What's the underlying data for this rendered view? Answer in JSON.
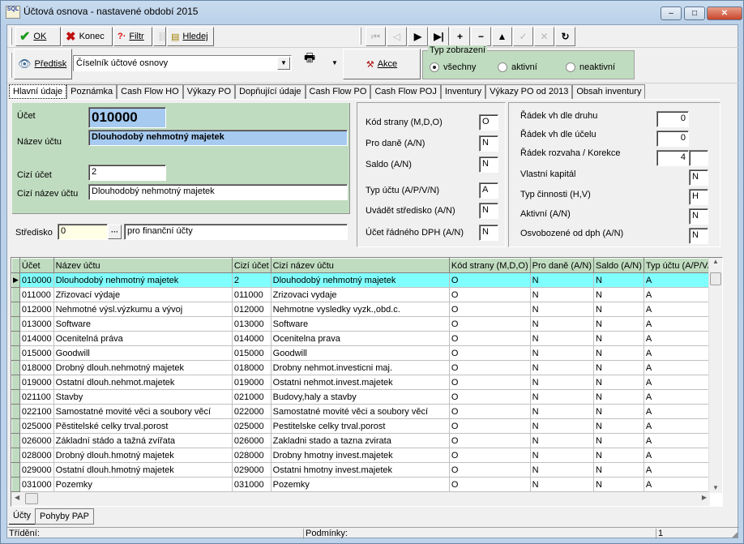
{
  "window": {
    "title": "Účtová osnova - nastavené období 2015",
    "app_icon": "SQL",
    "controls": {
      "minimize": "–",
      "maximize": "□",
      "close": "✕"
    }
  },
  "toolbar1": {
    "ok": {
      "label": "OK",
      "icon": "checkmark-icon"
    },
    "konec": {
      "label": "Konec",
      "icon": "x-icon"
    },
    "filtr": {
      "label": "Filtr",
      "icon": "question-icon"
    },
    "hledej": {
      "label": "Hledej",
      "icon": "search-icon"
    },
    "nav": [
      {
        "name": "first",
        "glyph": "⏮",
        "enabled": false
      },
      {
        "name": "prior",
        "glyph": "◁",
        "enabled": false
      },
      {
        "name": "next",
        "glyph": "▶",
        "enabled": true
      },
      {
        "name": "last",
        "glyph": "▶|",
        "enabled": true
      },
      {
        "name": "insert",
        "glyph": "+",
        "enabled": true
      },
      {
        "name": "delete",
        "glyph": "−",
        "enabled": true
      },
      {
        "name": "edit",
        "glyph": "▲",
        "enabled": true
      },
      {
        "name": "post",
        "glyph": "✓",
        "enabled": false
      },
      {
        "name": "cancel",
        "glyph": "✕",
        "enabled": false
      },
      {
        "name": "refresh",
        "glyph": "↻",
        "enabled": true
      }
    ]
  },
  "toolbar2": {
    "predtisk": "Předtisk",
    "report_select": "Číselník účtové osnovy",
    "akce": "Akce",
    "view_type": {
      "legend": "Typ zobrazení",
      "options": [
        "všechny",
        "aktivní",
        "neaktivní"
      ],
      "selected": "všechny"
    }
  },
  "tabs": [
    "Hlavní údaje",
    "Poznámka",
    "Cash Flow HO",
    "Výkazy PO",
    "Dopňující údaje",
    "Cash Flow PO",
    "Cash Flow POJ",
    "Inventury",
    "Výkazy PO od 2013",
    "Obsah inventury"
  ],
  "active_tab": "Hlavní údaje",
  "form": {
    "ucet": {
      "label": "Účet",
      "value": "010000"
    },
    "nazev_uctu": {
      "label": "Název účtu",
      "value": "Dlouhodobý nehmotný majetek"
    },
    "cizi_ucet": {
      "label": "Cizí účet",
      "value": "2"
    },
    "cizi_nazev": {
      "label": "Cizí název účtu",
      "value": "Dlouhodobý nehmotný majetek"
    },
    "stredisko": {
      "label": "Středisko",
      "value": "0",
      "description": "pro finanční účty"
    },
    "middle": [
      {
        "label": "Kód strany (M,D,O)",
        "value": "O"
      },
      {
        "label": "Pro daně (A/N)",
        "value": "N"
      },
      {
        "label": "Saldo (A/N)",
        "value": "N"
      },
      {
        "label": "Typ účtu (A/P/V/N)",
        "value": "A"
      },
      {
        "label": "Uvádět středisko (A/N)",
        "value": "N"
      },
      {
        "label": "Účet řádného DPH (A/N)",
        "value": "N"
      }
    ],
    "right": {
      "radek_druh": {
        "label": "Řádek vh dle druhu",
        "value": "0"
      },
      "radek_ucel": {
        "label": "Řádek vh dle účelu",
        "value": "0"
      },
      "radek_rozvaha": {
        "label": "Řádek rozvaha / Korekce",
        "value": "4",
        "korekce": ""
      },
      "vlastni_kapital": {
        "label": "Vlastní kapitál",
        "value": "N"
      },
      "typ_cinnosti": {
        "label": "Typ činnosti (H,V)",
        "value": "H"
      },
      "aktivni": {
        "label": "Aktivní (A/N)",
        "value": "N"
      },
      "osvobozene": {
        "label": "Osvobozené od dph (A/N)",
        "value": "N"
      }
    }
  },
  "grid": {
    "columns": [
      "Účet",
      "Název účtu",
      "Cizí účet",
      "Cizí název účtu",
      "Kód strany (M,D,O)",
      "Pro daně (A/N)",
      "Saldo (A/N)",
      "Typ účtu (A/P/V/N)"
    ],
    "rows": [
      [
        "010000",
        "Dlouhodobý nehmotný majetek",
        "2",
        "Dlouhodobý nehmotný majetek",
        "O",
        "N",
        "N",
        "A"
      ],
      [
        "011000",
        "Zřizovací výdaje",
        "011000",
        "Zrizovaci vydaje",
        "O",
        "N",
        "N",
        "A"
      ],
      [
        "012000",
        "Nehmotné výsl.výzkumu a vývoj",
        "012000",
        "Nehmotne vysledky vyzk.,obd.c.",
        "O",
        "N",
        "N",
        "A"
      ],
      [
        "013000",
        "Software",
        "013000",
        "Software",
        "O",
        "N",
        "N",
        "A"
      ],
      [
        "014000",
        "Ocenitelná práva",
        "014000",
        "Ocenitelna prava",
        "O",
        "N",
        "N",
        "A"
      ],
      [
        "015000",
        "Goodwill",
        "015000",
        "Goodwill",
        "O",
        "N",
        "N",
        "A"
      ],
      [
        "018000",
        "Drobný dlouh.nehmotný majetek",
        "018000",
        "Drobny nehmot.investicni maj.",
        "O",
        "N",
        "N",
        "A"
      ],
      [
        "019000",
        "Ostatní dlouh.nehmot.majetek",
        "019000",
        "Ostatni nehmot.invest.majetek",
        "O",
        "N",
        "N",
        "A"
      ],
      [
        "021100",
        "Stavby",
        "021000",
        "Budovy,haly a stavby",
        "O",
        "N",
        "N",
        "A"
      ],
      [
        "022100",
        "Samostatné movité věci a soubory věcí",
        "022000",
        "Samostatné movité věci a soubory věcí",
        "O",
        "N",
        "N",
        "A"
      ],
      [
        "025000",
        "Pěstitelské celky trval.porost",
        "025000",
        "Pestitelske celky trval.porost",
        "O",
        "N",
        "N",
        "A"
      ],
      [
        "026000",
        "Základní stádo a tažná zvířata",
        "026000",
        "Zakladni stado a tazna zvirata",
        "O",
        "N",
        "N",
        "A"
      ],
      [
        "028000",
        "Drobný dlouh.hmotný majetek",
        "028000",
        "Drobny hmotny invest.majetek",
        "O",
        "N",
        "N",
        "A"
      ],
      [
        "029000",
        "Ostatní dlouh.hmotný majetek",
        "029000",
        "Ostatni hmotny invest.majetek",
        "O",
        "N",
        "N",
        "A"
      ],
      [
        "031000",
        "Pozemky",
        "031000",
        "Pozemky",
        "O",
        "N",
        "N",
        "A"
      ]
    ],
    "selected_row": 0
  },
  "bottom_tabs": [
    "Účty",
    "Pohyby PAP"
  ],
  "active_bottom_tab": "Účty",
  "status": {
    "trideni": "Třídění:",
    "podminky": "Podmínky:",
    "record": "1"
  }
}
